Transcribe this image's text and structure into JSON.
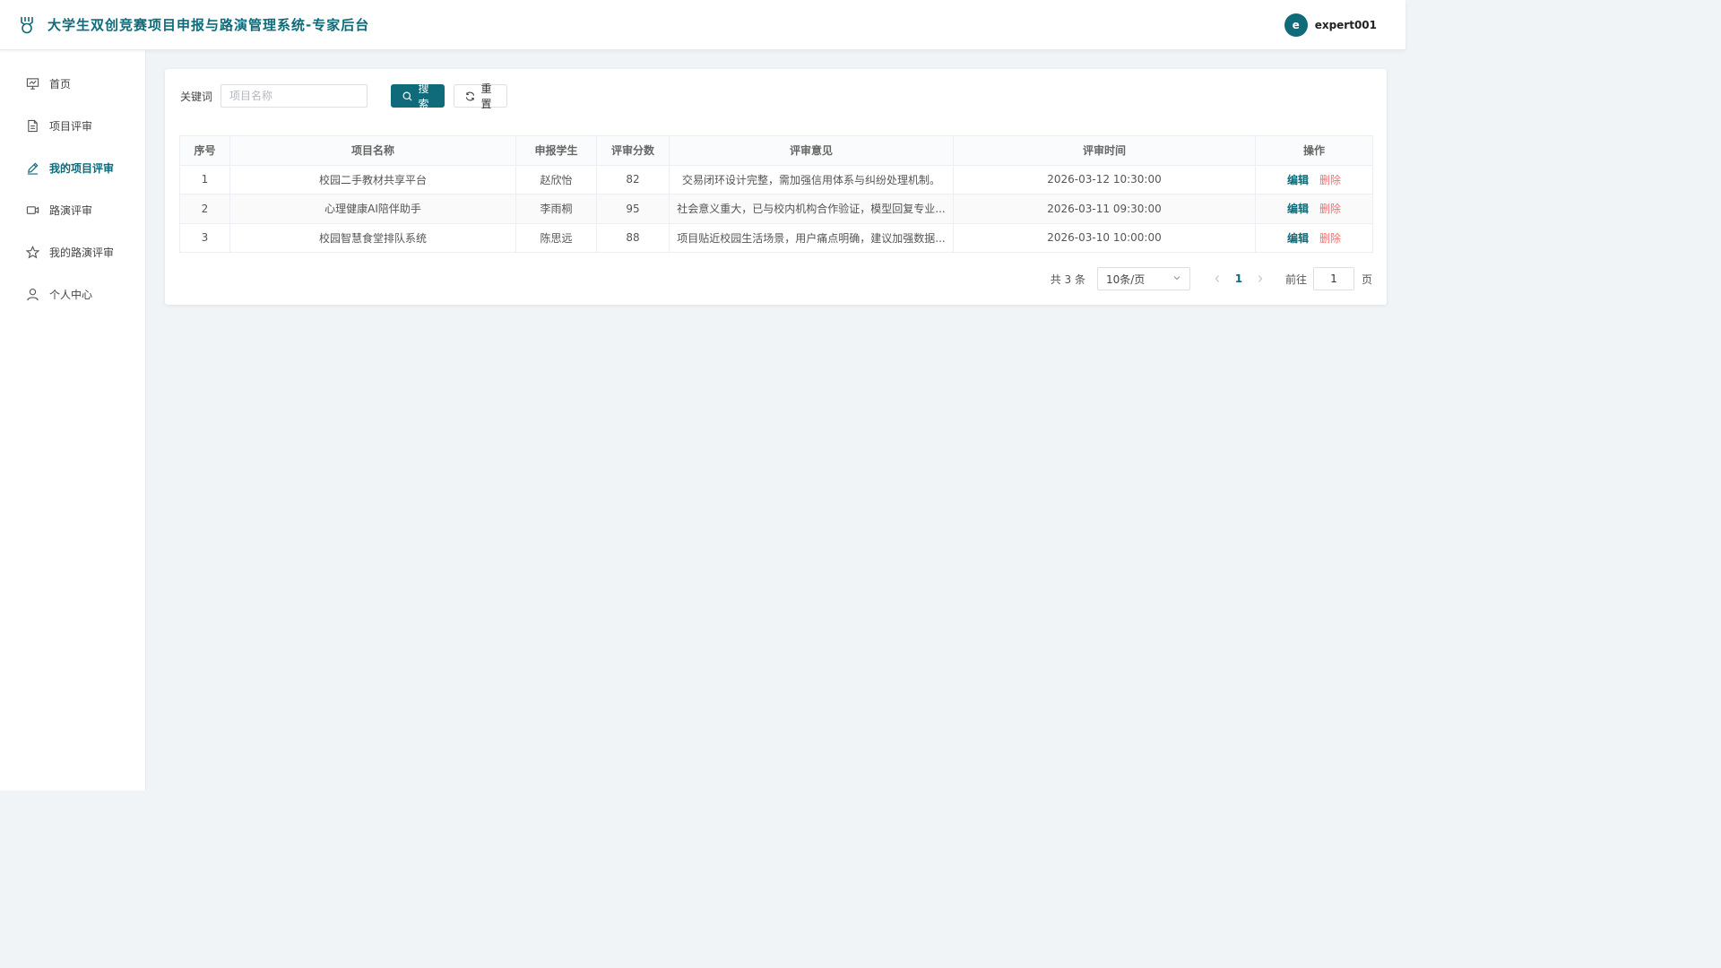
{
  "header": {
    "title": "大学生双创竞赛项目申报与路演管理系统-专家后台",
    "user_initial": "e",
    "username": "expert001",
    "accent": "#0f6a7a"
  },
  "sidebar": {
    "items": [
      {
        "label": "首页",
        "icon": "presentation-board-icon",
        "active": false
      },
      {
        "label": "项目评审",
        "icon": "document-icon",
        "active": false
      },
      {
        "label": "我的项目评审",
        "icon": "pen-icon",
        "active": true
      },
      {
        "label": "路演评审",
        "icon": "video-camera-icon",
        "active": false
      },
      {
        "label": "我的路演评审",
        "icon": "star-icon",
        "active": false
      },
      {
        "label": "个人中心",
        "icon": "user-icon",
        "active": false
      }
    ]
  },
  "filter": {
    "label": "关键词",
    "placeholder": "项目名称",
    "value": "",
    "search_label": "搜索",
    "reset_label": "重置"
  },
  "table": {
    "columns": [
      "序号",
      "项目名称",
      "申报学生",
      "评审分数",
      "评审意见",
      "评审时间",
      "操作"
    ],
    "rows": [
      {
        "index": "1",
        "name": "校园二手教材共享平台",
        "student": "赵欣怡",
        "score": "82",
        "comment": "交易闭环设计完整，需加强信用体系与纠纷处理机制。",
        "time": "2026-03-12 10:30:00"
      },
      {
        "index": "2",
        "name": "心理健康AI陪伴助手",
        "student": "李雨桐",
        "score": "95",
        "comment": "社会意义重大，已与校内机构合作验证，模型回复专业...",
        "time": "2026-03-11 09:30:00"
      },
      {
        "index": "3",
        "name": "校园智慧食堂排队系统",
        "student": "陈思远",
        "score": "88",
        "comment": "项目贴近校园生活场景，用户痛点明确，建议加强数据...",
        "time": "2026-03-10 10:00:00"
      }
    ],
    "edit_label": "编辑",
    "delete_label": "删除"
  },
  "pagination": {
    "total_text": "共 3 条",
    "page_size": "10条/页",
    "current_page": "1",
    "goto_label": "前往",
    "goto_value": "1",
    "goto_unit": "页"
  }
}
